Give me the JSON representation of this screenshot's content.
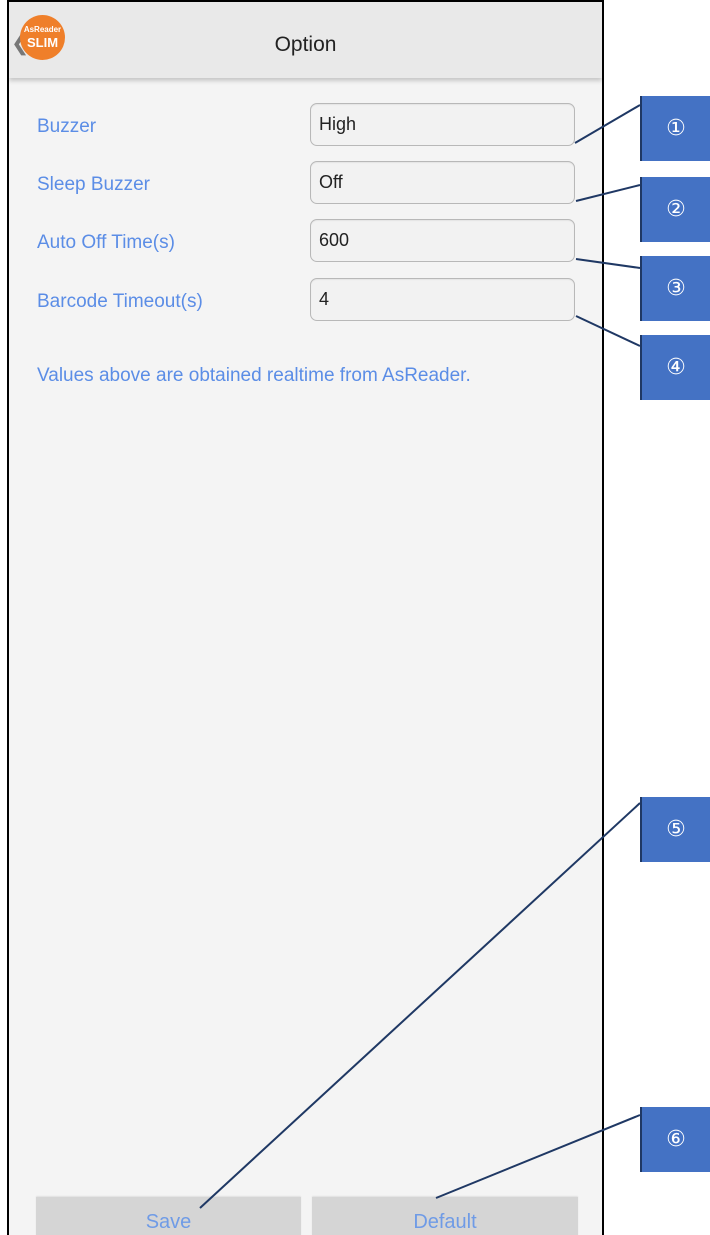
{
  "header": {
    "title": "Option",
    "logo_line1": "AsReader",
    "logo_line2": "SLIM",
    "back_glyph": "❮"
  },
  "settings": [
    {
      "label": "Buzzer",
      "value": "High"
    },
    {
      "label": "Sleep Buzzer",
      "value": "Off"
    },
    {
      "label": "Auto Off Time(s)",
      "value": "600"
    },
    {
      "label": "Barcode Timeout(s)",
      "value": "4"
    }
  ],
  "note": "Values above are obtained realtime from AsReader.",
  "buttons": {
    "save": "Save",
    "default": "Default"
  },
  "callouts": [
    "①",
    "②",
    "③",
    "④",
    "⑤",
    "⑥"
  ],
  "colors": {
    "accent_text": "#5b8de6",
    "callout_fill": "#4472c4",
    "callout_line": "#1f3864",
    "logo_orange": "#ef7f2a"
  },
  "icons": {
    "back": "chevron-left-icon",
    "logo": "asreader-slim-logo"
  }
}
